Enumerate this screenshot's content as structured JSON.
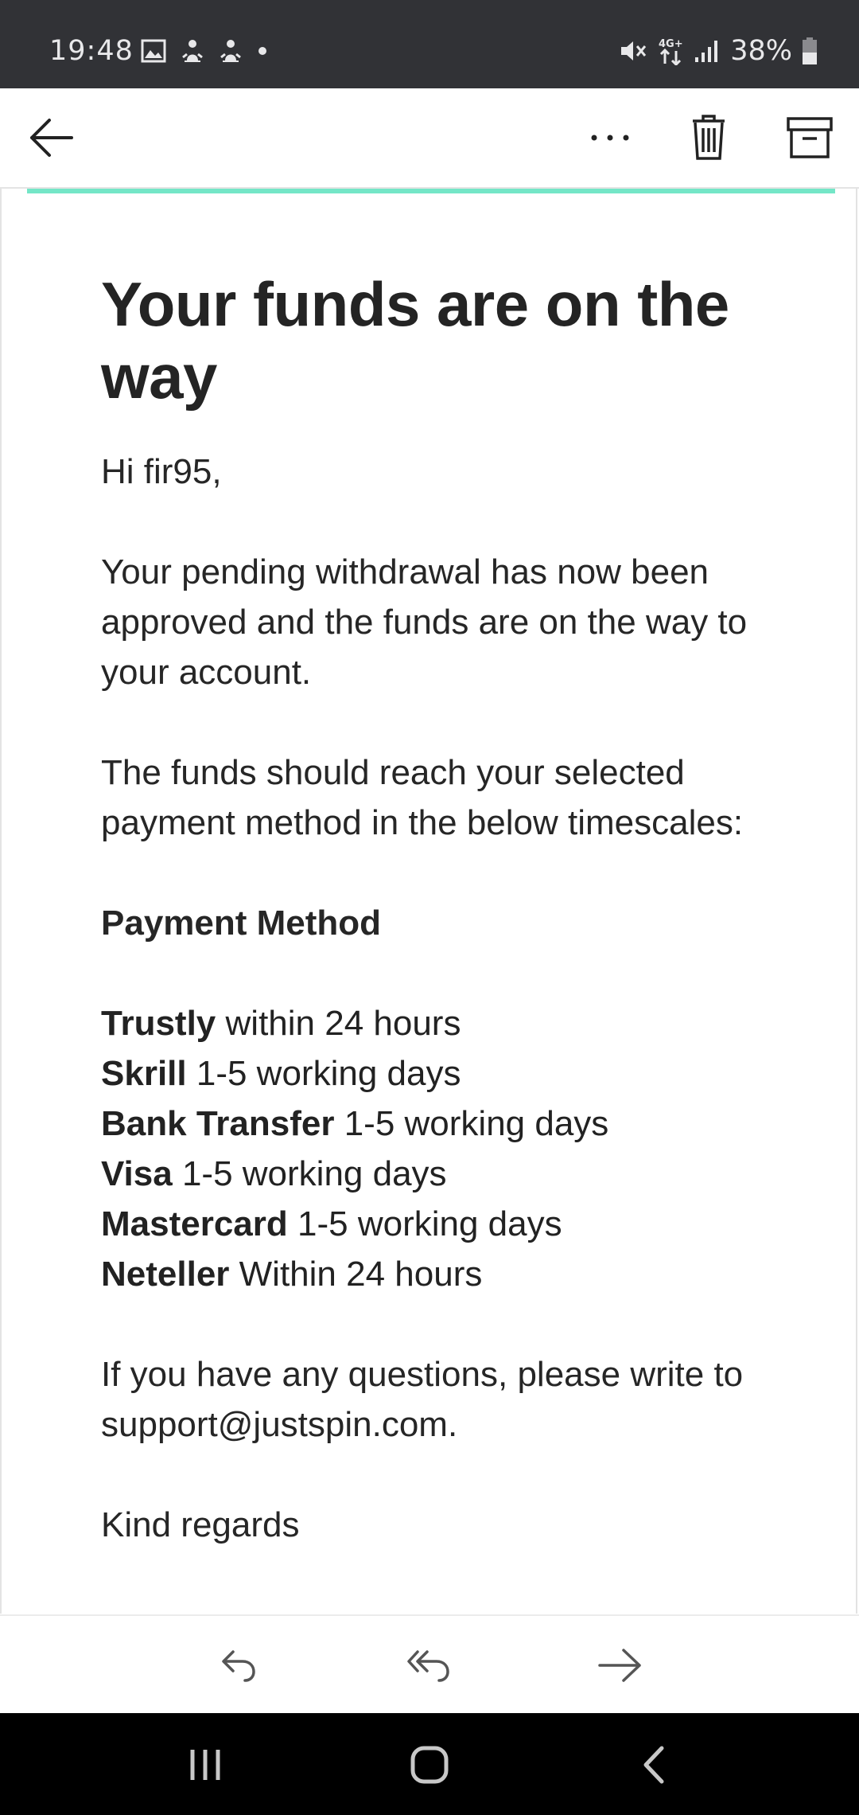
{
  "status_bar": {
    "time": "19:48",
    "battery": "38%",
    "icons": [
      "image-icon",
      "notification-icon",
      "notification-icon",
      "dot-icon",
      "mute-icon",
      "4g-icon",
      "signal-icon",
      "battery-icon"
    ],
    "network": "4G+"
  },
  "toolbar": {
    "back_icon": "arrow-left-icon",
    "more_icon": "more-horizontal-icon",
    "delete_icon": "trash-icon",
    "archive_icon": "archive-icon"
  },
  "accent_color": "#74e6c7",
  "email": {
    "headline": "Your funds are on the way",
    "greeting": "Hi fir95,",
    "para1": "Your pending withdrawal has now been approved and the funds are on the way to your account.",
    "para2": "The funds should reach your selected payment method in the below timescales:",
    "methods_heading": "Payment Method",
    "methods": [
      {
        "name": "Trustly",
        "time": "within 24 hours"
      },
      {
        "name": "Skrill",
        "time": "1-5 working days"
      },
      {
        "name": "Bank Transfer",
        "time": "1-5 working days"
      },
      {
        "name": "Visa",
        "time": "1-5 working days"
      },
      {
        "name": "Mastercard",
        "time": "1-5 working days"
      },
      {
        "name": "Neteller",
        "time": "Within 24 hours"
      }
    ],
    "support_text": "If you have any questions, please write to support@justspin.com.",
    "sign_off": "Kind regards"
  },
  "bottom_actions": {
    "reply_icon": "reply-icon",
    "reply_all_icon": "reply-all-icon",
    "forward_icon": "forward-icon"
  },
  "nav": {
    "recents_icon": "recents-icon",
    "home_icon": "home-icon",
    "back_icon": "back-chevron-icon"
  }
}
